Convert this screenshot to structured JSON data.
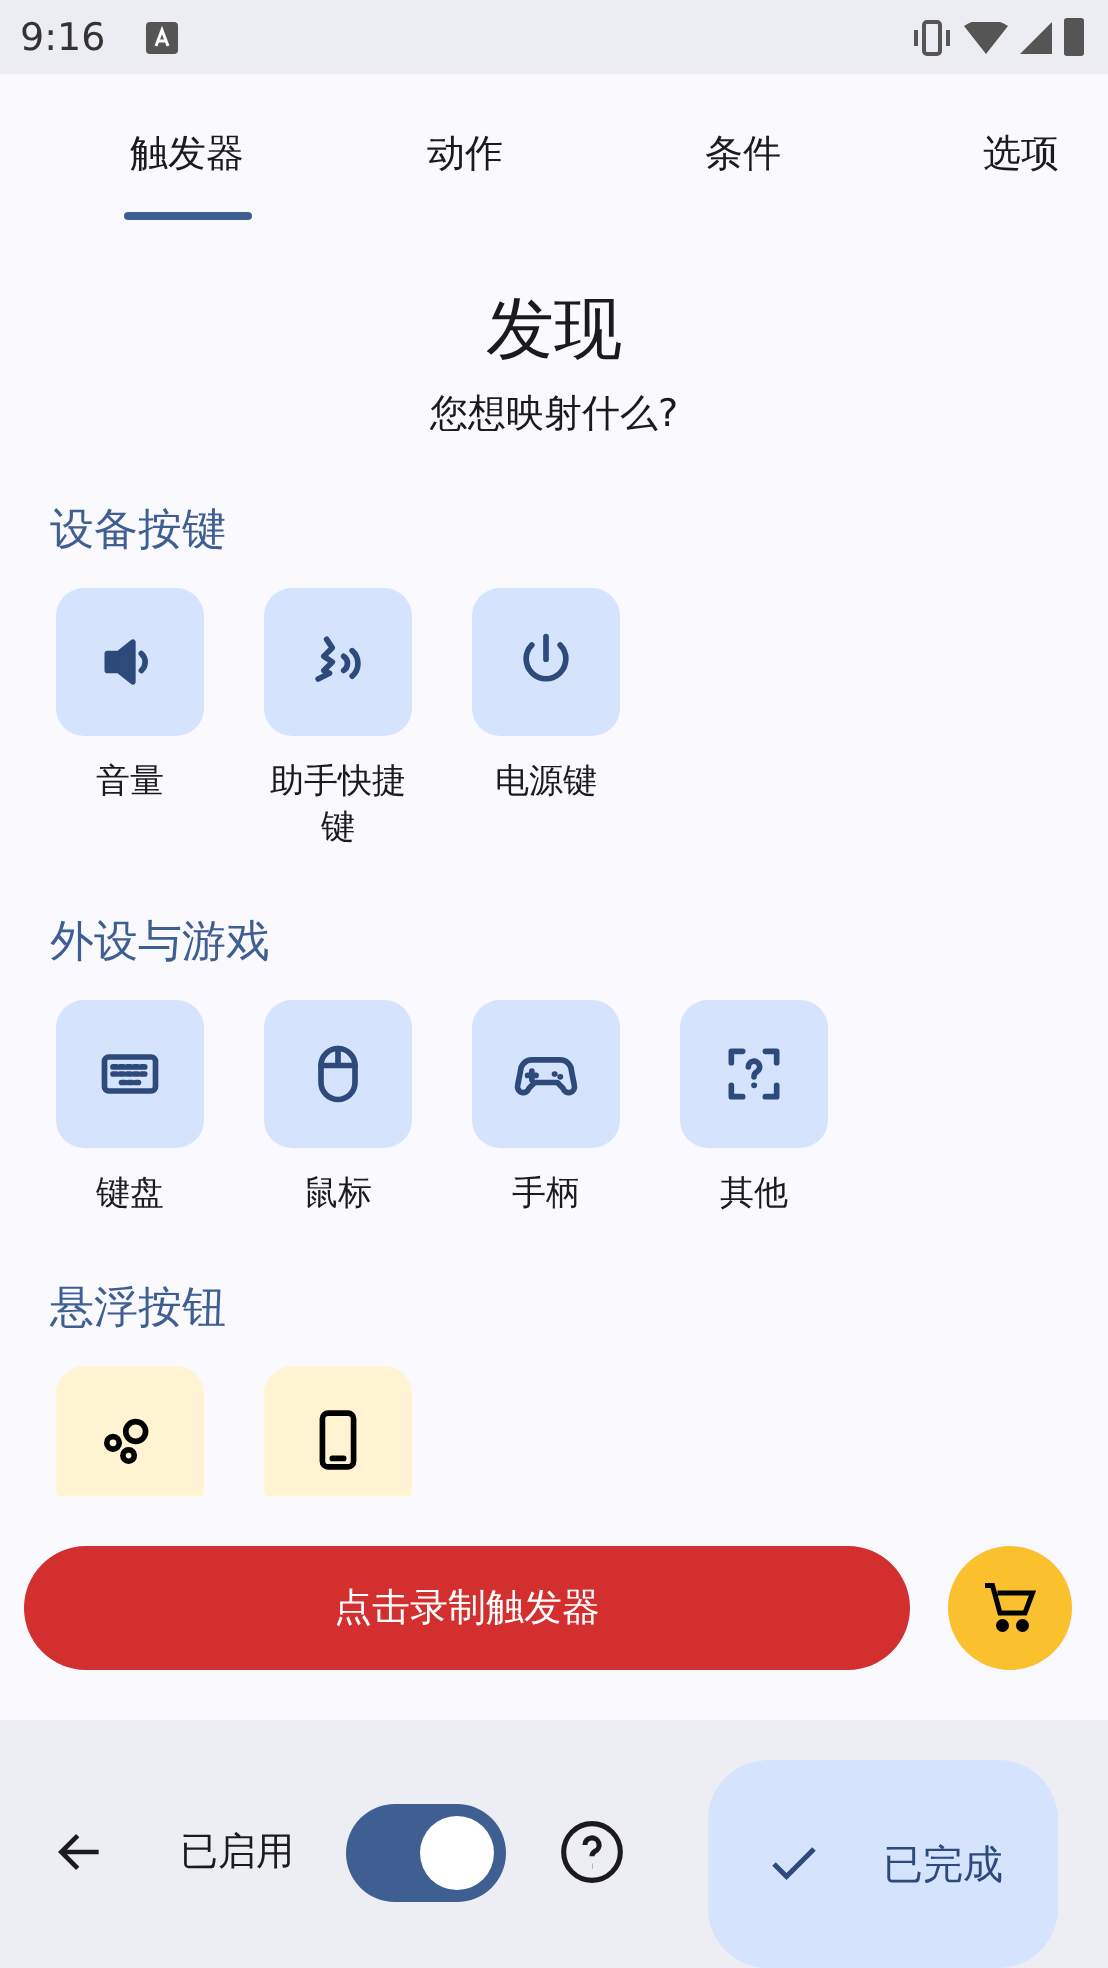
{
  "status_bar": {
    "time": "9:16"
  },
  "tabs": [
    {
      "label": "触发器",
      "selected": true
    },
    {
      "label": "动作",
      "selected": false
    },
    {
      "label": "条件",
      "selected": false
    },
    {
      "label": "选项",
      "selected": false
    }
  ],
  "title": "发现",
  "subtitle": "您想映射什么?",
  "sections": [
    {
      "heading": "设备按键",
      "color": "#d6e3fd",
      "items": [
        {
          "kind": "volume",
          "label": "音量"
        },
        {
          "kind": "assistant",
          "label": "助手快捷键"
        },
        {
          "kind": "power",
          "label": "电源键"
        }
      ]
    },
    {
      "heading": "外设与游戏",
      "color": "#d6e3fd",
      "items": [
        {
          "kind": "keyboard",
          "label": "键盘"
        },
        {
          "kind": "mouse",
          "label": "鼠标"
        },
        {
          "kind": "gamepad",
          "label": "手柄"
        },
        {
          "kind": "other",
          "label": "其他"
        }
      ]
    },
    {
      "heading": "悬浮按钮",
      "color": "#fff3d1",
      "items": [
        {
          "kind": "bubbles"
        },
        {
          "kind": "phone"
        }
      ]
    }
  ],
  "record_button": "点击录制触发器",
  "bottom_bar": {
    "enabled_label": "已启用",
    "enabled": true,
    "done_button": "已完成"
  }
}
